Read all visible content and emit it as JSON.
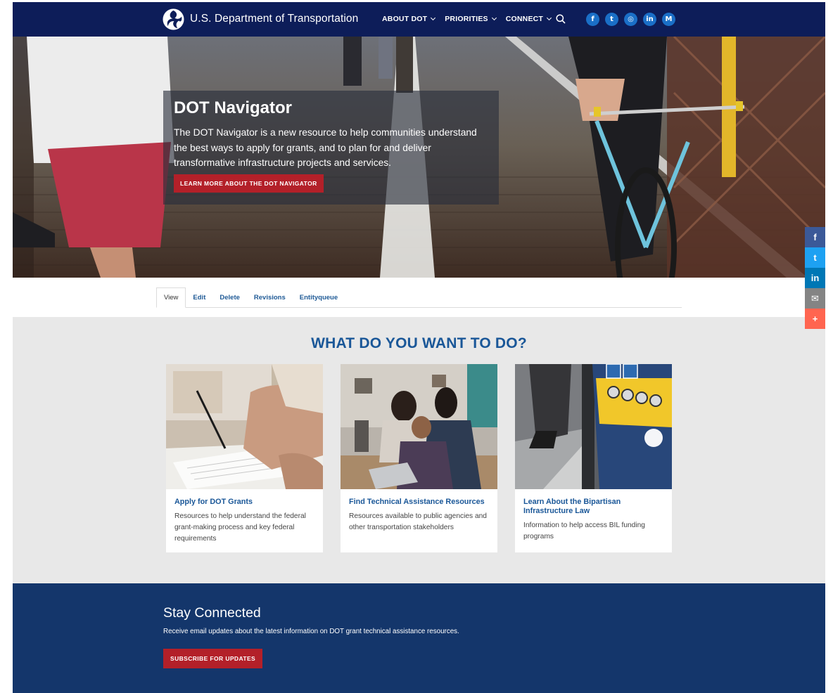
{
  "header": {
    "site_name": "U.S. Department of Transportation",
    "nav": [
      {
        "label": "ABOUT DOT"
      },
      {
        "label": "PRIORITIES"
      },
      {
        "label": "CONNECT"
      }
    ],
    "social": [
      {
        "icon": "facebook-icon",
        "glyph": "f"
      },
      {
        "icon": "twitter-icon",
        "glyph": "t"
      },
      {
        "icon": "instagram-icon",
        "glyph": "◎"
      },
      {
        "icon": "linkedin-icon",
        "glyph": "in"
      },
      {
        "icon": "medium-icon",
        "glyph": "M"
      }
    ],
    "brand_color": "#0d1d59"
  },
  "hero": {
    "title": "DOT Navigator",
    "text": "The DOT Navigator is a new resource to help communities understand the best ways to apply for grants, and to plan for and deliver transformative infrastructure projects and services.",
    "button_label": "LEARN MORE ABOUT THE DOT NAVIGATOR"
  },
  "share_bar": [
    {
      "icon": "facebook-share-icon",
      "glyph": "f",
      "color": "#3b5998"
    },
    {
      "icon": "twitter-share-icon",
      "glyph": "t",
      "color": "#1da1f2"
    },
    {
      "icon": "linkedin-share-icon",
      "glyph": "in",
      "color": "#0077b5"
    },
    {
      "icon": "email-share-icon",
      "glyph": "✉",
      "color": "#848484"
    },
    {
      "icon": "more-share-icon",
      "glyph": "+",
      "color": "#ff6550"
    }
  ],
  "tabs": [
    {
      "label": "View",
      "active": true
    },
    {
      "label": "Edit"
    },
    {
      "label": "Delete"
    },
    {
      "label": "Revisions"
    },
    {
      "label": "Entityqueue"
    }
  ],
  "section": {
    "title": "WHAT DO YOU WANT TO DO?"
  },
  "cards": [
    {
      "title": "Apply for DOT Grants",
      "description": "Resources to help understand the federal grant-making process and key federal requirements"
    },
    {
      "title": "Find Technical Assistance Resources",
      "description": "Resources available to public agencies and other transportation stakeholders"
    },
    {
      "title": "Learn About the Bipartisan Infrastructure Law",
      "description": "Information to help access BIL funding programs"
    }
  ],
  "footer": {
    "title": "Stay Connected",
    "text": "Receive email updates about the latest information on DOT grant technical assistance resources.",
    "button_label": "SUBSCRIBE FOR UPDATES"
  },
  "colors": {
    "accent_red": "#b32029",
    "link_blue": "#1a5798",
    "footer_blue": "#14366b"
  }
}
